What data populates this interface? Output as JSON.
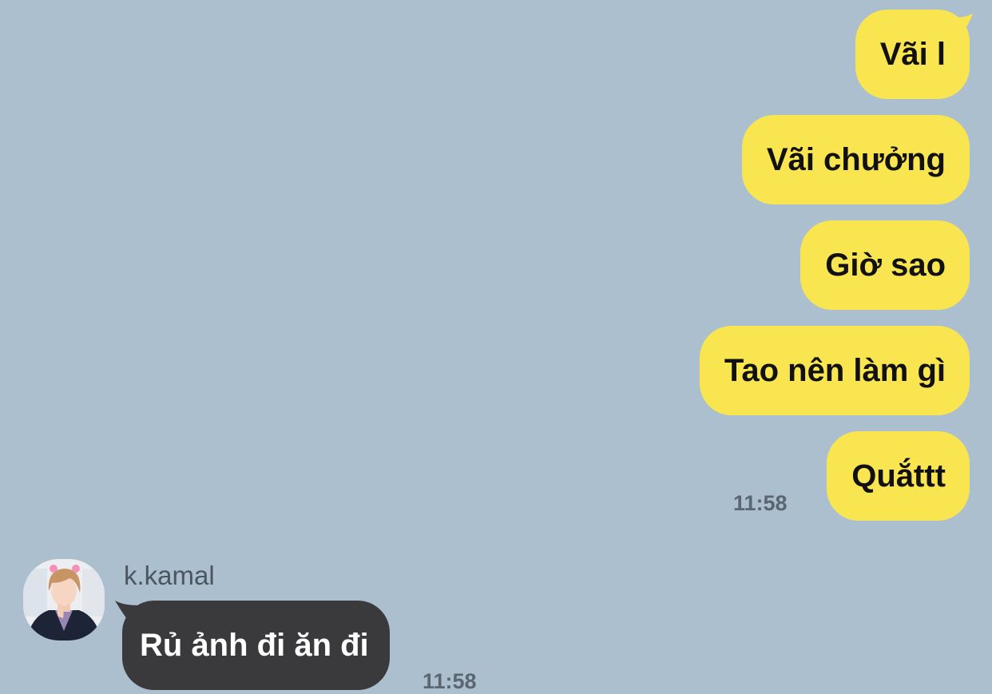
{
  "colors": {
    "background": "#acbfcf",
    "outgoing_bubble": "#f9e54f",
    "incoming_bubble": "#3a3a3c",
    "timestamp": "#5b6670"
  },
  "outgoing_messages": [
    {
      "text": "Vãi l"
    },
    {
      "text": "Vãi chưởng"
    },
    {
      "text": "Giờ sao"
    },
    {
      "text": "Tao nên làm gì"
    },
    {
      "text": "Quắttt",
      "time": "11:58"
    }
  ],
  "incoming": {
    "sender": "k.kamal",
    "avatar_icon": "profile-photo-avatar",
    "messages": [
      {
        "text": "Rủ ảnh đi ăn đi",
        "time": "11:58"
      }
    ]
  }
}
